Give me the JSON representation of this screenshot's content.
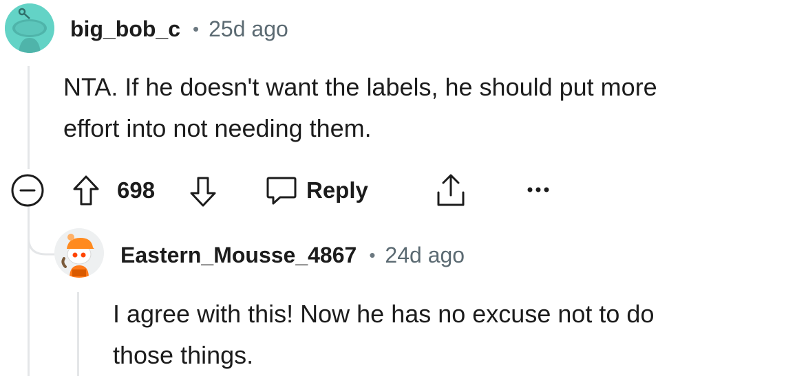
{
  "comments": [
    {
      "username": "big_bob_c",
      "separator": "•",
      "timestamp": "25d ago",
      "avatar_icon": "snoo-avatar-icon",
      "avatar_color": "#63d3c6",
      "body_lines": [
        "NTA. If he doesn't want the labels, he should put more",
        "effort into not needing them."
      ],
      "actions": {
        "collapse_icon": "minus-circle-icon",
        "upvote_icon": "arrow-up-icon",
        "vote_count": "698",
        "downvote_icon": "arrow-down-icon",
        "reply_icon": "chat-bubble-icon",
        "reply_label": "Reply",
        "share_icon": "share-icon",
        "more_icon": "ellipsis-icon"
      }
    },
    {
      "username": "Eastern_Mousse_4867",
      "separator": "•",
      "timestamp": "24d ago",
      "avatar_icon": "snoo-avatar-orange-cap-icon",
      "body_lines": [
        "I agree with this! Now he has no excuse not to do",
        "those things."
      ]
    }
  ],
  "colors": {
    "thread_line": "#e4e6e8",
    "timestamp": "#5b6a72",
    "text": "#1c1c1c"
  }
}
